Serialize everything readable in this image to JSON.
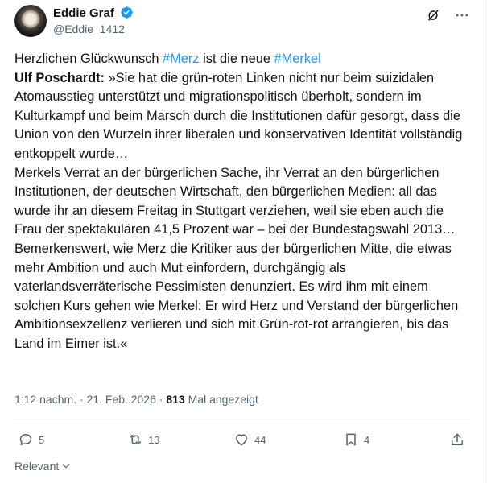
{
  "author": {
    "display_name": "Eddie Graf",
    "handle": "@Eddie_1412"
  },
  "tweet": {
    "line1_prefix": "Herzlichen Glückwunsch ",
    "hashtag1": "#Merz",
    "line1_middle": " ist die neue ",
    "hashtag2": "#Merkel",
    "quote_author": "Ulf Poschardt:",
    "paragraph1": " »Sie hat die grün-roten Linken nicht nur beim suizidalen Atomausstieg unterstützt und migrationspolitisch überholt, sondern im Kulturkampf und beim Marsch durch die Institutionen dafür gesorgt, dass die Union von den Wurzeln ihrer liberalen und konservativen Identität vollständig entkoppelt wurde…",
    "paragraph2": "Merkels Verrat an der bürgerlichen Sache, ihr Verrat an den bürgerlichen Institutionen, der deutschen Wirtschaft, den bürgerlichen Medien: all das wurde ihr an diesem Freitag in Stuttgart verziehen, weil sie eben auch die Frau der spektakulären 41,5 Prozent war – bei der Bundestagswahl 2013…",
    "paragraph3": "Bemerkenswert, wie Merz die Kritiker aus der bürgerlichen Mitte, die etwas mehr Ambition und auch Mut einfordern, durchgängig als vaterlandsverräterische Pessimisten denunziert. Es wird ihm mit einem solchen Kurs gehen wie Merkel: Er wird Herz und Verstand der bürgerlichen Ambitionsexzellenz verlieren und sich mit Grün-rot-rot arrangieren, bis das Land im Eimer ist.«"
  },
  "meta": {
    "time": "1:12 nachm.",
    "separator": " · ",
    "date": "21. Feb. 2026",
    "views_count": "813",
    "views_label": " Mal angezeigt"
  },
  "actions": {
    "replies": "5",
    "reposts": "13",
    "likes": "44",
    "bookmarks": "4"
  },
  "footer": {
    "relevant_label": "Relevant"
  },
  "colors": {
    "accent": "#1d9bf0",
    "text": "#0f1419",
    "muted": "#536471",
    "divider": "#eff3f4"
  },
  "icons": [
    "verified-badge-icon",
    "grok-icon",
    "more-icon",
    "reply-icon",
    "repost-icon",
    "like-icon",
    "bookmark-icon",
    "share-icon",
    "chevron-down-icon"
  ]
}
